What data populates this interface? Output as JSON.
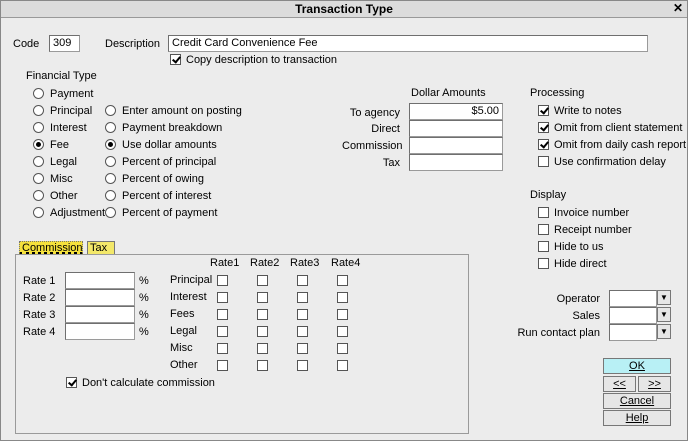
{
  "window": {
    "title": "Transaction Type",
    "close_label": "✕"
  },
  "code": {
    "label": "Code",
    "value": "309"
  },
  "description": {
    "label": "Description",
    "value": "Credit Card Convenience Fee",
    "copy_label": "Copy description to transaction",
    "copy_checked": true
  },
  "financial_type": {
    "title": "Financial Type",
    "left": [
      "Payment",
      "Principal",
      "Interest",
      "Fee",
      "Legal",
      "Misc",
      "Other",
      "Adjustment"
    ],
    "left_selected": "Fee",
    "right": [
      "Enter amount on posting",
      "Payment breakdown",
      "Use dollar amounts",
      "Percent of principal",
      "Percent of owing",
      "Percent of interest",
      "Percent of payment"
    ],
    "right_selected": "Use dollar amounts"
  },
  "dollar_amounts": {
    "title": "Dollar Amounts",
    "rows": [
      {
        "label": "To agency",
        "value": "$5.00"
      },
      {
        "label": "Direct",
        "value": ""
      },
      {
        "label": "Commission",
        "value": ""
      },
      {
        "label": "Tax",
        "value": ""
      }
    ]
  },
  "processing": {
    "title": "Processing",
    "items": [
      {
        "label": "Write to notes",
        "checked": true
      },
      {
        "label": "Omit from client statement",
        "checked": true
      },
      {
        "label": "Omit from daily cash report",
        "checked": true
      },
      {
        "label": "Use confirmation delay",
        "checked": false
      }
    ]
  },
  "display": {
    "title": "Display",
    "items": [
      {
        "label": "Invoice number",
        "checked": false
      },
      {
        "label": "Receipt number",
        "checked": false
      },
      {
        "label": "Hide to us",
        "checked": false
      },
      {
        "label": "Hide direct",
        "checked": false
      }
    ]
  },
  "tabs": {
    "commission": "Commission",
    "tax": "Tax"
  },
  "commission": {
    "rates": [
      {
        "label": "Rate 1",
        "value": ""
      },
      {
        "label": "Rate 2",
        "value": ""
      },
      {
        "label": "Rate 3",
        "value": ""
      },
      {
        "label": "Rate 4",
        "value": ""
      }
    ],
    "percent_symbol": "%",
    "grid_columns": [
      "Rate1",
      "Rate2",
      "Rate3",
      "Rate4"
    ],
    "grid_rows": [
      "Principal",
      "Interest",
      "Fees",
      "Legal",
      "Misc",
      "Other"
    ],
    "dont_calc_label": "Don't calculate commission",
    "dont_calc_checked": true
  },
  "right_fields": {
    "operator_label": "Operator",
    "sales_label": "Sales",
    "run_contact_plan_label": "Run contact plan",
    "dropdown_glyph": "▼"
  },
  "buttons": {
    "ok": "OK",
    "prev": "<<",
    "next": ">>",
    "cancel": "Cancel",
    "help": "Help"
  }
}
